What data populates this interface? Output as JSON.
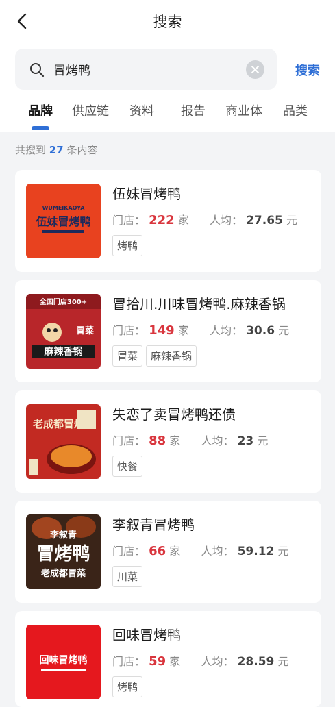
{
  "nav": {
    "title": "搜索"
  },
  "search": {
    "value": "冒烤鸭",
    "button_label": "搜索"
  },
  "tabs": [
    {
      "label": "品牌"
    },
    {
      "label": "供应链"
    },
    {
      "label": "资料"
    },
    {
      "label": "报告"
    },
    {
      "label": "商业体"
    },
    {
      "label": "品类"
    }
  ],
  "count": {
    "prefix": "共搜到",
    "num": "27",
    "suffix": "条内容"
  },
  "labels": {
    "stores": "门店：",
    "stores_unit": "家",
    "avg": "人均：",
    "avg_unit": "元"
  },
  "results": [
    {
      "name": "伍妹冒烤鸭",
      "stores": "222",
      "avg": "27.65",
      "tags": [
        "烤鸭"
      ],
      "logo_text": "伍妹冒烤鸭",
      "logo_sub": "WUMEIKAOYA",
      "logo_bg": "#e8421f"
    },
    {
      "name": "冒拾川.川味冒烤鸭.麻辣香锅",
      "stores": "149",
      "avg": "30.6",
      "tags": [
        "冒菜",
        "麻辣香锅"
      ],
      "logo_text": "麻辣香锅",
      "logo_sub": "全国门店300+",
      "logo_sub2": "冒菜",
      "logo_bg": "#b8262a"
    },
    {
      "name": "失恋了卖冒烤鸭还债",
      "stores": "88",
      "avg": "23",
      "tags": [
        "快餐"
      ],
      "logo_text": "老成都冒烤鸭",
      "logo_bg": "#c22a22"
    },
    {
      "name": "李叙青冒烤鸭",
      "stores": "66",
      "avg": "59.12",
      "tags": [
        "川菜"
      ],
      "logo_text": "冒烤鸭",
      "logo_sub": "李叙青",
      "logo_sub2": "老成都冒菜",
      "logo_bg": "#3a2418"
    },
    {
      "name": "回味冒烤鸭",
      "stores": "59",
      "avg": "28.59",
      "tags": [
        "烤鸭"
      ],
      "logo_text": "回味冒烤鸭",
      "logo_bg": "#e5181e"
    }
  ]
}
